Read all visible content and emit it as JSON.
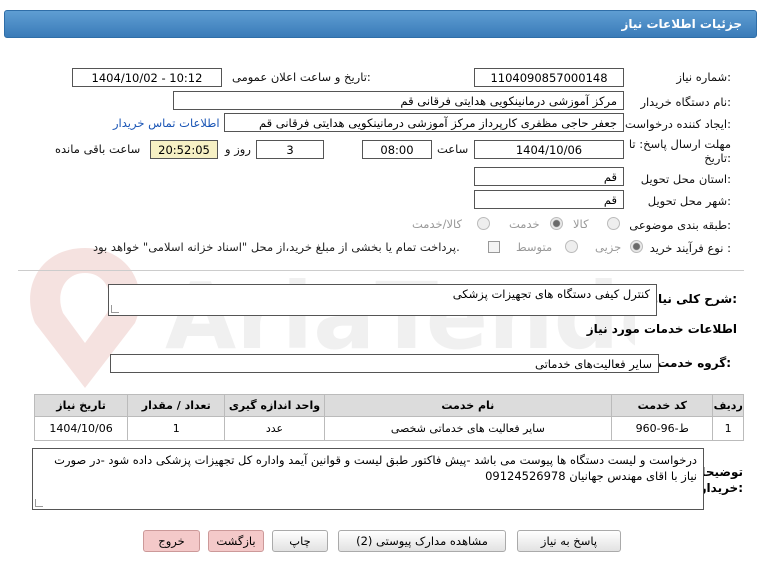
{
  "header": {
    "title": "جزئیات اطلاعات نیاز"
  },
  "need_number": {
    "label": "شماره نیاز:",
    "value": "1104090857000148"
  },
  "announce": {
    "label": "تاریخ و ساعت اعلان عمومی:",
    "value": "1404/10/02 - 10:12"
  },
  "buyer": {
    "label": "نام دستگاه خریدار:",
    "value": "مرکز آموزشی درمانینکویی هدایتی فرقانی قم"
  },
  "creator": {
    "label": "ایجاد کننده درخواست:",
    "value": "جعفر حاجی مظفری کارپرداز مرکز آموزشی درمانینکویی هدایتی فرقانی قم",
    "contact_link": "اطلاعات تماس خریدار"
  },
  "deadline": {
    "label_line1": "مهلت ارسال پاسخ: تا",
    "label_line2": "تاریخ:",
    "date": "1404/10/06",
    "time_label": "ساعت",
    "time": "08:00",
    "days": "3",
    "days_label": "روز و",
    "remaining": "20:52:05",
    "remaining_label": "ساعت باقی مانده"
  },
  "province": {
    "label": "استان محل تحویل:",
    "value": "قم"
  },
  "city": {
    "label": "شهر محل تحویل:",
    "value": "قم"
  },
  "category": {
    "label": "طبقه بندی موضوعی:",
    "options": [
      "کالا",
      "خدمت",
      "کالا/خدمت"
    ],
    "selected": "خدمت"
  },
  "process": {
    "label": "نوع فرآیند خرید :",
    "options": [
      "جزیی",
      "متوسط"
    ],
    "selected": "جزیی",
    "checkbox_text": "پرداخت تمام یا بخشی از مبلغ خرید،از محل \"اسناد خزانه اسلامی\" خواهد بود."
  },
  "description": {
    "label": "شرح کلی نیاز:",
    "value": "کنترل کیفی دستگاه های تجهیزات پزشکی"
  },
  "services_info": {
    "title": "اطلاعات خدمات مورد نیاز"
  },
  "service_group": {
    "label": "گروه خدمت:",
    "value": "سایر فعالیت‌های خدماتی"
  },
  "table": {
    "headers": [
      "ردیف",
      "کد خدمت",
      "نام خدمت",
      "واحد اندازه گیری",
      "تعداد / مقدار",
      "تاریخ نیاز"
    ],
    "rows": [
      [
        "1",
        "ط-96-960",
        "سایر فعالیت های خدماتی شخصی",
        "عدد",
        "1",
        "1404/10/06"
      ]
    ]
  },
  "buyer_notes": {
    "label_line1": "توضیحات",
    "label_line2": "خریدار:",
    "value": "درخواست و لیست  دستگاه ها پیوست می باشد -پیش فاکتور طبق لیست و قوانین آیمد واداره کل تجهیزات پزشکی داده شود  -در صورت نیاز با اقای مهندس جهانیان  09124526978"
  },
  "buttons": {
    "reply": "پاسخ به نیاز",
    "attachments": "مشاهده مدارک پیوستی (2)",
    "print": "چاپ",
    "back": "بازگشت",
    "exit": "خروج"
  },
  "watermark": {
    "text": "AriaTender.net"
  }
}
